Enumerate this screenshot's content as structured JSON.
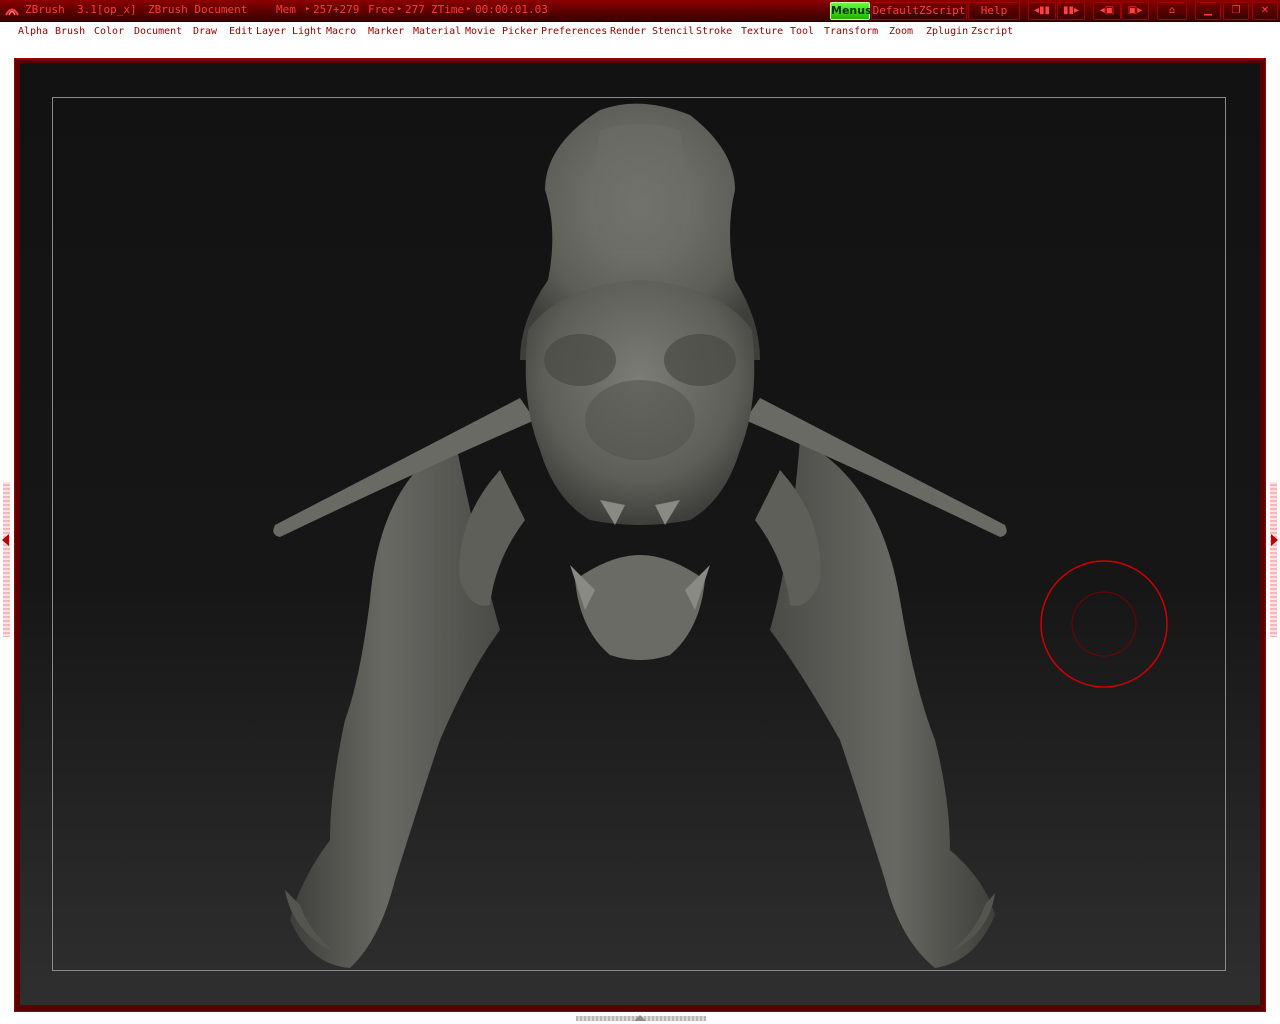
{
  "titlebar": {
    "app_name": "ZBrush",
    "version": "3.1[op_x]",
    "document": "ZBrush Document",
    "mem_label": "Mem",
    "mem_value": "257+279",
    "free_label": "Free",
    "free_value": "277",
    "ztime_label": "ZTime",
    "ztime_value": "00:00:01.03",
    "menus_button": "Menus",
    "script_button": "DefaultZScript",
    "help_button": "Help",
    "icons": [
      "move-left-icon",
      "move-right-icon",
      "tile-icon",
      "layout-icon",
      "lock-icon",
      "minimize-icon",
      "restore-icon",
      "close-icon"
    ]
  },
  "menubar": {
    "items": [
      "Alpha",
      "Brush",
      "Color",
      "Document",
      "Draw",
      "Edit",
      "Layer",
      "Light",
      "Macro",
      "Marker",
      "Material",
      "Movie",
      "Picker",
      "Preferences",
      "Render",
      "Stencil",
      "Stroke",
      "Texture",
      "Tool",
      "Transform",
      "Zoom",
      "Zplugin",
      "Zscript"
    ]
  },
  "colors": {
    "titlebar_bg": "#5a0000",
    "title_text": "#ff3a3a",
    "menu_text": "#a00000",
    "menus_green": "#33d400",
    "canvas_dark": "#121212",
    "model_grey": "#6e6e69",
    "cursor_red": "#d00000"
  },
  "canvas": {
    "model": "sculpted creature mesh",
    "cursor": "brush-cursor-icon"
  }
}
